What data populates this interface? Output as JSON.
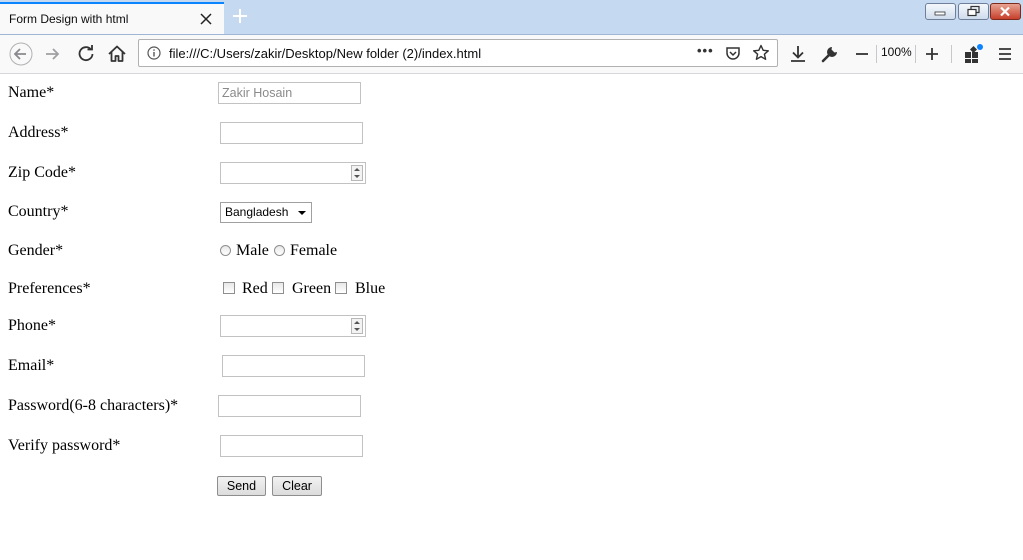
{
  "browser": {
    "tab_title": "Form Design with html",
    "url": "file:///C:/Users/zakir/Desktop/New folder (2)/index.html",
    "zoom": "100%",
    "more_label": "•••"
  },
  "form": {
    "name_label": "Name*",
    "name_placeholder": "Zakir Hosain",
    "address_label": "Address*",
    "zip_label": "Zip Code*",
    "country_label": "Country*",
    "country_selected": "Bangladesh",
    "gender_label": "Gender*",
    "gender_options": [
      "Male",
      "Female"
    ],
    "preferences_label": "Preferences*",
    "preference_options": [
      "Red",
      "Green",
      "Blue"
    ],
    "phone_label": "Phone*",
    "email_label": "Email*",
    "password_label": "Password(6-8 characters)*",
    "verify_label": "Verify password*",
    "send_label": "Send",
    "clear_label": "Clear"
  }
}
